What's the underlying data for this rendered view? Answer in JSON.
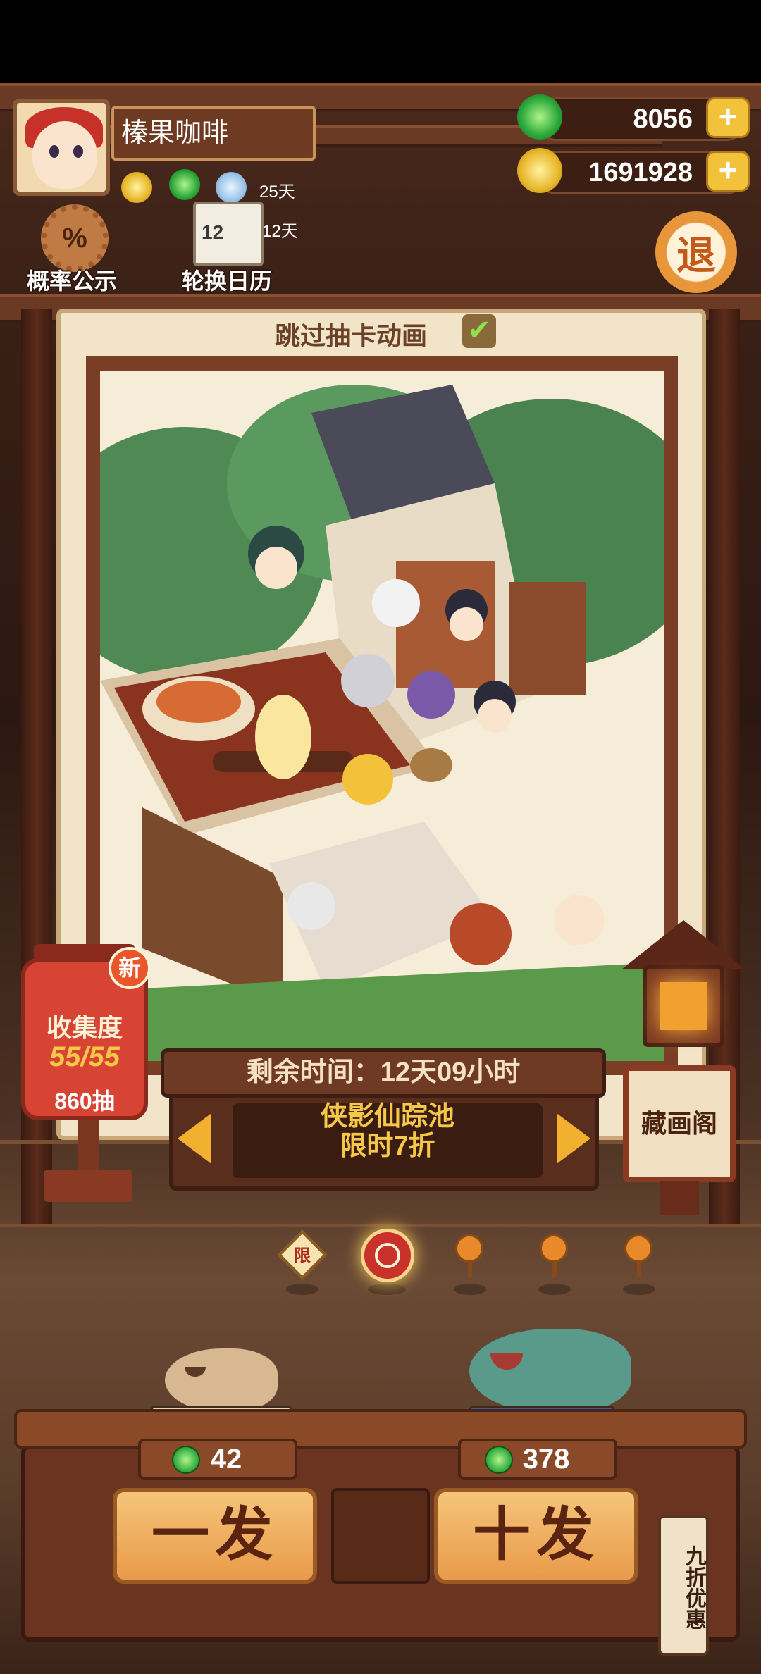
{
  "player": {
    "name": "榛果咖啡"
  },
  "buffs": [
    {
      "icon": "coin-boost-icon",
      "days": ""
    },
    {
      "icon": "jade-boost-icon",
      "days": ""
    },
    {
      "icon": "exp-boost-icon",
      "days": "25天"
    },
    {
      "icon": "calendar-boost-icon",
      "days": "12天"
    }
  ],
  "header": {
    "probability_label": "概率公示",
    "probability_symbol": "%",
    "calendar_label": "轮换日历",
    "calendar_number": "12",
    "exit_label": "退"
  },
  "currencies": {
    "jade": "8056",
    "coins": "1691928",
    "plus_symbol": "+"
  },
  "card": {
    "skip_label": "跳过抽卡动画",
    "skip_checked": true,
    "check_symbol": "✔"
  },
  "collection": {
    "badge": "新",
    "label": "收集度",
    "value": "55/55",
    "draws": "860抽"
  },
  "pool": {
    "timer": "剩余时间：12天09小时",
    "name": "侠影仙踪池",
    "discount": "限时7折"
  },
  "gallery": {
    "label": "藏画阁"
  },
  "pool_dots": [
    {
      "label": "限",
      "selected": false
    },
    {
      "label": "",
      "selected": true
    },
    {
      "label": "",
      "selected": false
    },
    {
      "label": "",
      "selected": false
    },
    {
      "label": "",
      "selected": false
    }
  ],
  "draw": {
    "single_cost": "42",
    "ten_cost": "378",
    "single_label": "一发",
    "ten_label": "十发",
    "discount_tag": "九折优惠"
  },
  "colors": {
    "accent": "#f2b030",
    "wood_dark": "#3e1e12",
    "lantern_red": "#d84434"
  }
}
